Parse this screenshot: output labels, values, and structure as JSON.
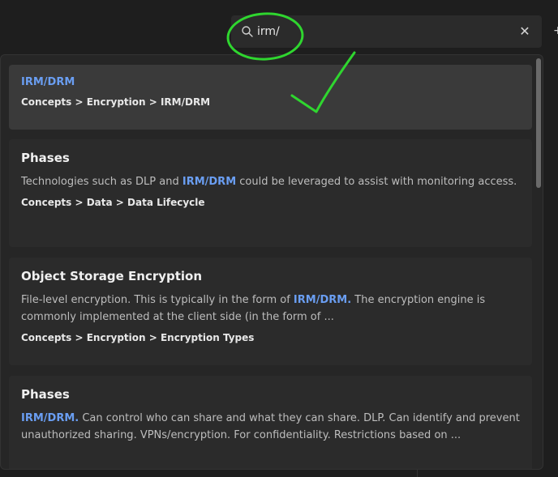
{
  "search": {
    "value": "irm/",
    "clear_icon": "close-icon"
  },
  "results": [
    {
      "title": "IRM/DRM",
      "snippet_parts": [],
      "path": "Concepts > Encryption > IRM/DRM"
    },
    {
      "title": "Phases",
      "snippet_parts": [
        {
          "text": "Technologies such as DLP and ",
          "hl": false
        },
        {
          "text": "IRM/DRM",
          "hl": true
        },
        {
          "text": " could be leveraged to assist with monitoring access.",
          "hl": false
        }
      ],
      "path": "Concepts > Data > Data Lifecycle"
    },
    {
      "title": "Object Storage Encryption",
      "snippet_parts": [
        {
          "text": "File-level encryption. This is typically in the form of ",
          "hl": false
        },
        {
          "text": "IRM/DRM.",
          "hl": true
        },
        {
          "text": " The encryption engine is commonly implemented at the client side (in the form of ...",
          "hl": false
        }
      ],
      "path": "Concepts > Encryption > Encryption Types"
    },
    {
      "title": "Phases",
      "snippet_parts": [
        {
          "text": "IRM/DRM.",
          "hl": true
        },
        {
          "text": " Can control who can share and what they can share. DLP. Can identify and prevent unauthorized sharing. VPNs/encryption. For confidentiality. Restrictions based on ...",
          "hl": false
        }
      ],
      "path": ""
    }
  ],
  "colors": {
    "highlight": "#6a9ef2",
    "annotation": "#2fd62f"
  }
}
